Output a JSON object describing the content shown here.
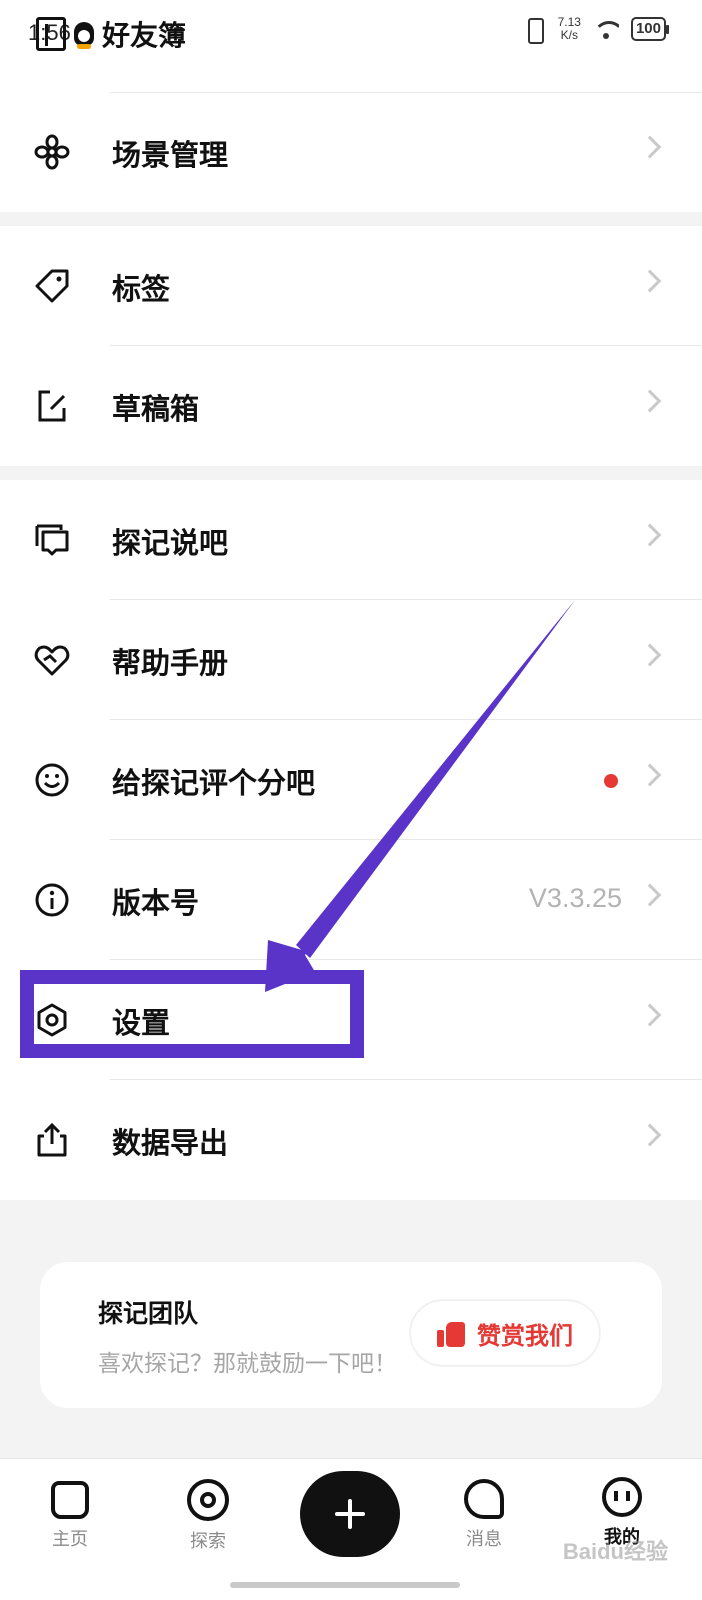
{
  "status_bar": {
    "time": "1:56",
    "app_title": "好友簿",
    "net_speed": "7.13",
    "net_unit": "K/s",
    "battery": "100"
  },
  "menu": {
    "scene": "场景管理",
    "tags": "标签",
    "drafts": "草稿箱",
    "forum": "探记说吧",
    "help": "帮助手册",
    "rate": "给探记评个分吧",
    "version_label": "版本号",
    "version_value": "V3.3.25",
    "settings": "设置",
    "export": "数据导出"
  },
  "team_card": {
    "title": "探记团队",
    "subtitle": "喜欢探记？那就鼓励一下吧！",
    "reward_button": "赞赏我们"
  },
  "bottom_nav": {
    "home": "主页",
    "explore": "探索",
    "messages": "消息",
    "me": "我的"
  },
  "colors": {
    "annotation": "#5a33c9",
    "badge": "#e53935",
    "reward": "#e53935"
  },
  "watermark": "Baidu经验"
}
